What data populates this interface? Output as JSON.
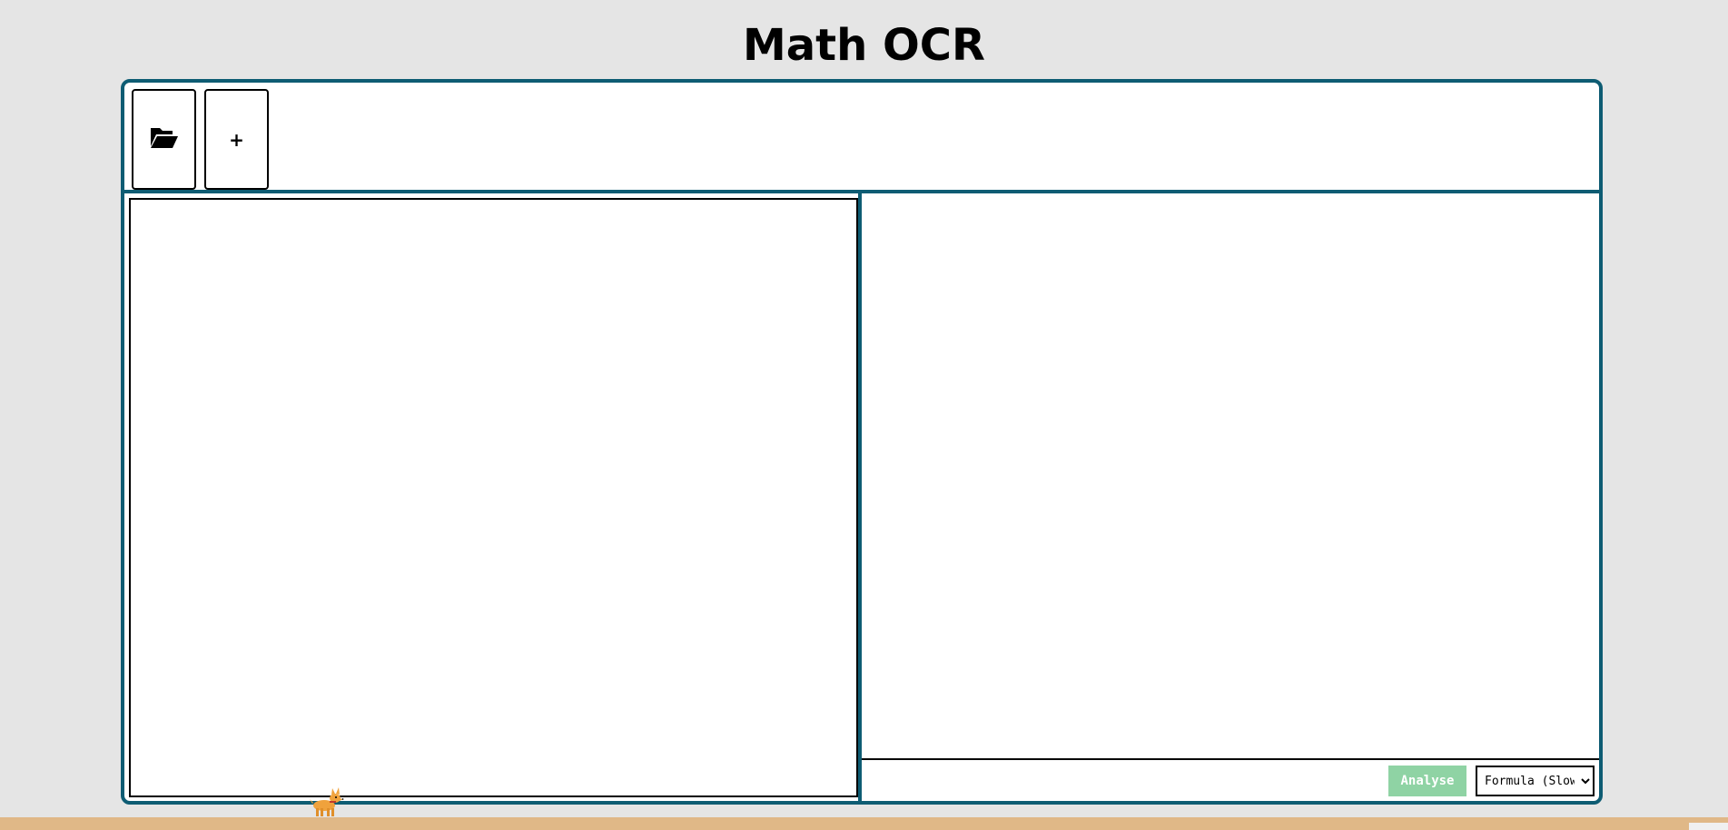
{
  "header": {
    "title": "Math OCR"
  },
  "toolbar": {
    "open_icon": "folder-open-icon",
    "add_label": "+"
  },
  "controls": {
    "analyse_label": "Analyse",
    "mode": {
      "selected": "Formula (Slow)",
      "options": [
        "Formula (Slow)"
      ]
    }
  },
  "colors": {
    "page_bg": "#e5e5e5",
    "frame_border": "#0e5c73",
    "analyse_bg": "#8fd3a4",
    "ground": "#e0b887"
  },
  "mascot": {
    "icon": "dog-icon"
  }
}
